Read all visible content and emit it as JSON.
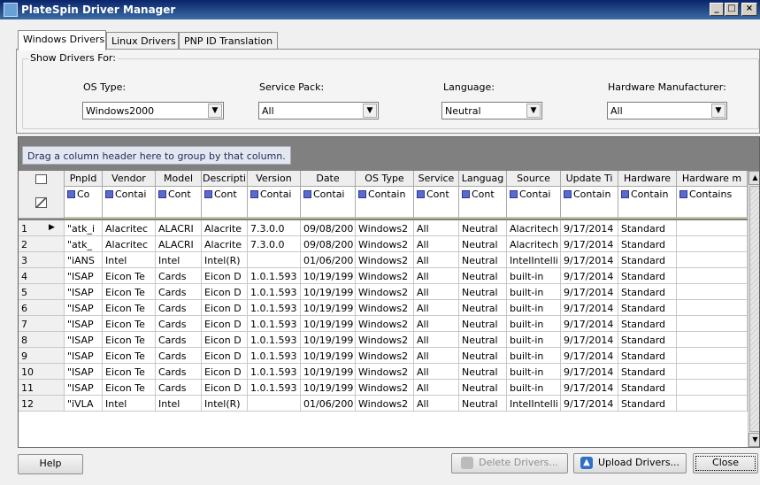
{
  "window": {
    "title": "PlateSpin Driver Manager",
    "controls": [
      "_",
      "□",
      "×"
    ]
  },
  "tabs": [
    {
      "label": "Windows Drivers",
      "active": true
    },
    {
      "label": "Linux Drivers",
      "active": false
    },
    {
      "label": "PNP ID Translation",
      "active": false
    }
  ],
  "filters": {
    "group_label": "Show Drivers For:",
    "os_type": {
      "label": "OS Type:",
      "value": "Windows2000"
    },
    "service_pack": {
      "label": "Service Pack:",
      "value": "All"
    },
    "language": {
      "label": "Language:",
      "value": "Neutral"
    },
    "hardware_manufacturer": {
      "label": "Hardware Manufacturer:",
      "value": "All"
    }
  },
  "grid": {
    "group_hint": "Drag a column header here to group by that column.",
    "columns": [
      "PnpId",
      "Vendor",
      "Model",
      "Descripti",
      "Version",
      "Date",
      "OS Type",
      "Service",
      "Languag",
      "Source",
      "Update Ti",
      "Hardware",
      "Hardware m"
    ],
    "filter_labels": [
      "Co",
      "Contai",
      "Cont",
      "Cont",
      "Contai",
      "Contai",
      "Contain",
      "Cont",
      "Cont",
      "Contai",
      "Contain",
      "Contain",
      "Contains"
    ],
    "rows": [
      {
        "num": "1",
        "current": true,
        "cells": [
          "\"atk_i",
          "Alacritec",
          "ALACRI",
          "Alacrite",
          "7.3.0.0",
          "09/08/200",
          "Windows2",
          "All",
          "Neutral",
          "Alacritech",
          "9/17/2014",
          "Standard",
          ""
        ]
      },
      {
        "num": "2",
        "current": false,
        "cells": [
          "\"atk_",
          "Alacritec",
          "ALACRI",
          "Alacrite",
          "7.3.0.0",
          "09/08/200",
          "Windows2",
          "All",
          "Neutral",
          "Alacritech",
          "9/17/2014",
          "Standard",
          ""
        ]
      },
      {
        "num": "3",
        "current": false,
        "cells": [
          "\"iANS",
          "Intel",
          "Intel",
          "Intel(R)",
          "",
          "01/06/200",
          "Windows2",
          "All",
          "Neutral",
          "IntelIntelli",
          "9/17/2014",
          "Standard",
          ""
        ]
      },
      {
        "num": "4",
        "current": false,
        "cells": [
          "\"ISAP",
          "Eicon Te",
          "Cards",
          "Eicon D",
          "1.0.1.593",
          "10/19/199",
          "Windows2",
          "All",
          "Neutral",
          "built-in",
          "9/17/2014",
          "Standard",
          ""
        ]
      },
      {
        "num": "5",
        "current": false,
        "cells": [
          "\"ISAP",
          "Eicon Te",
          "Cards",
          "Eicon D",
          "1.0.1.593",
          "10/19/199",
          "Windows2",
          "All",
          "Neutral",
          "built-in",
          "9/17/2014",
          "Standard",
          ""
        ]
      },
      {
        "num": "6",
        "current": false,
        "cells": [
          "\"ISAP",
          "Eicon Te",
          "Cards",
          "Eicon D",
          "1.0.1.593",
          "10/19/199",
          "Windows2",
          "All",
          "Neutral",
          "built-in",
          "9/17/2014",
          "Standard",
          ""
        ]
      },
      {
        "num": "7",
        "current": false,
        "cells": [
          "\"ISAP",
          "Eicon Te",
          "Cards",
          "Eicon D",
          "1.0.1.593",
          "10/19/199",
          "Windows2",
          "All",
          "Neutral",
          "built-in",
          "9/17/2014",
          "Standard",
          ""
        ]
      },
      {
        "num": "8",
        "current": false,
        "cells": [
          "\"ISAP",
          "Eicon Te",
          "Cards",
          "Eicon D",
          "1.0.1.593",
          "10/19/199",
          "Windows2",
          "All",
          "Neutral",
          "built-in",
          "9/17/2014",
          "Standard",
          ""
        ]
      },
      {
        "num": "9",
        "current": false,
        "cells": [
          "\"ISAP",
          "Eicon Te",
          "Cards",
          "Eicon D",
          "1.0.1.593",
          "10/19/199",
          "Windows2",
          "All",
          "Neutral",
          "built-in",
          "9/17/2014",
          "Standard",
          ""
        ]
      },
      {
        "num": "10",
        "current": false,
        "cells": [
          "\"ISAP",
          "Eicon Te",
          "Cards",
          "Eicon D",
          "1.0.1.593",
          "10/19/199",
          "Windows2",
          "All",
          "Neutral",
          "built-in",
          "9/17/2014",
          "Standard",
          ""
        ]
      },
      {
        "num": "11",
        "current": false,
        "cells": [
          "\"ISAP",
          "Eicon Te",
          "Cards",
          "Eicon D",
          "1.0.1.593",
          "10/19/199",
          "Windows2",
          "All",
          "Neutral",
          "built-in",
          "9/17/2014",
          "Standard",
          ""
        ]
      },
      {
        "num": "12",
        "current": false,
        "cells": [
          "\"iVLA",
          "Intel",
          "Intel",
          "Intel(R)",
          "",
          "01/06/200",
          "Windows2",
          "All",
          "Neutral",
          "IntelIntelli",
          "9/17/2014",
          "Standard",
          ""
        ]
      }
    ]
  },
  "buttons": {
    "help": "Help",
    "delete": "Delete Drivers...",
    "upload": "Upload Drivers...",
    "close": "Close"
  },
  "icons": {
    "delete": "delete-drivers-icon",
    "upload": "upload-arrow-icon",
    "column_chooser": "column-chooser-icon",
    "clear_filter": "clear-filter-icon"
  }
}
